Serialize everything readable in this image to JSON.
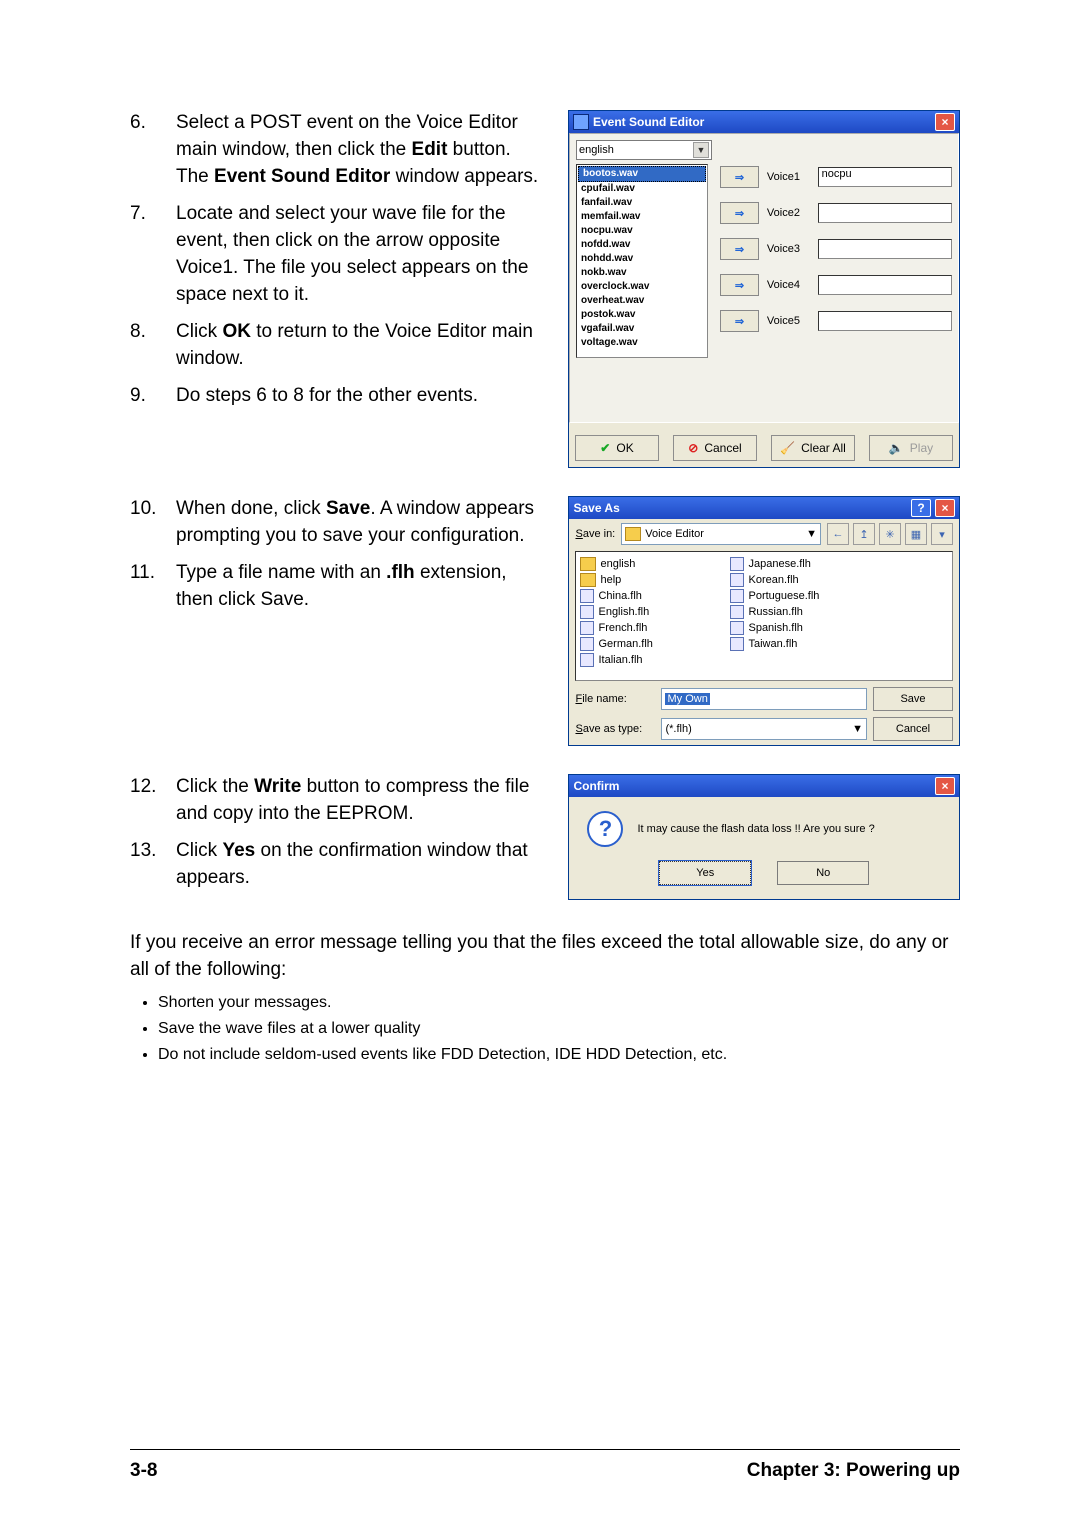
{
  "steps_a": [
    {
      "n": "6.",
      "html": "Select a POST event on the Voice Editor main window, then click the <strong>Edit</strong> button. The <strong>Event Sound Editor</strong> window appears."
    },
    {
      "n": "7.",
      "html": "Locate and select your wave file for the event, then click on the arrow opposite Voice1. The file you select appears on the space next to it."
    },
    {
      "n": "8.",
      "html": "Click <strong>OK</strong> to return to the Voice Editor main window."
    },
    {
      "n": "9.",
      "html": "Do steps 6 to 8 for the other events."
    }
  ],
  "steps_b": [
    {
      "n": "10.",
      "html": "When done, click <strong>Save</strong>. A window appears prompting you to save your configuration."
    },
    {
      "n": "11.",
      "html": "Type a file name with an <strong>.flh</strong> extension, then click Save."
    }
  ],
  "steps_c": [
    {
      "n": "12.",
      "html": "Click the <strong>Write</strong> button to compress the file and copy into the EEPROM."
    },
    {
      "n": "13.",
      "html": "Click <strong>Yes</strong> on the confirmation window that appears."
    }
  ],
  "body_after": "If you receive an error message telling you that the files exceed the total allowable size, do any or all of the following:",
  "bullets": [
    "Shorten your messages.",
    "Save the wave files at a lower quality",
    "Do not include seldom-used events like FDD Detection, IDE HDD Detection, etc."
  ],
  "editor": {
    "title": "Event Sound Editor",
    "lang_selected": "english",
    "files": [
      "bootos.wav",
      "cpufail.wav",
      "fanfail.wav",
      "memfail.wav",
      "nocpu.wav",
      "nofdd.wav",
      "nohdd.wav",
      "nokb.wav",
      "overclock.wav",
      "overheat.wav",
      "postok.wav",
      "vgafail.wav",
      "voltage.wav"
    ],
    "selected_index": 0,
    "voices": [
      {
        "label": "Voice1",
        "value": "nocpu"
      },
      {
        "label": "Voice2",
        "value": ""
      },
      {
        "label": "Voice3",
        "value": ""
      },
      {
        "label": "Voice4",
        "value": ""
      },
      {
        "label": "Voice5",
        "value": ""
      }
    ],
    "buttons": {
      "ok": "OK",
      "cancel": "Cancel",
      "clear": "Clear All",
      "play": "Play"
    }
  },
  "saveas": {
    "title": "Save As",
    "savein_label": "Save in:",
    "savein_value": "Voice Editor",
    "tools": [
      "←",
      "↥",
      "✳",
      "▦",
      "▾"
    ],
    "files_col": [
      {
        "type": "folder",
        "name": "english"
      },
      {
        "type": "folder",
        "name": "help"
      },
      {
        "type": "file",
        "name": "China.flh"
      },
      {
        "type": "file",
        "name": "English.flh"
      },
      {
        "type": "file",
        "name": "French.flh"
      },
      {
        "type": "file",
        "name": "German.flh"
      },
      {
        "type": "file",
        "name": "Italian.flh"
      },
      {
        "type": "file",
        "name": "Japanese.flh"
      },
      {
        "type": "file",
        "name": "Korean.flh"
      },
      {
        "type": "file",
        "name": "Portuguese.flh"
      },
      {
        "type": "file",
        "name": "Russian.flh"
      },
      {
        "type": "file",
        "name": "Spanish.flh"
      },
      {
        "type": "file",
        "name": "Taiwan.flh"
      }
    ],
    "filename_label": "File name:",
    "filename_value": "My Own",
    "type_label": "Save as type:",
    "type_value": "(*.flh)",
    "save": "Save",
    "cancel": "Cancel"
  },
  "confirm": {
    "title": "Confirm",
    "msg": "It may cause the flash data loss !!  Are you sure ?",
    "yes": "Yes",
    "no": "No"
  },
  "footer": {
    "left": "3-8",
    "right": "Chapter 3: Powering up"
  }
}
